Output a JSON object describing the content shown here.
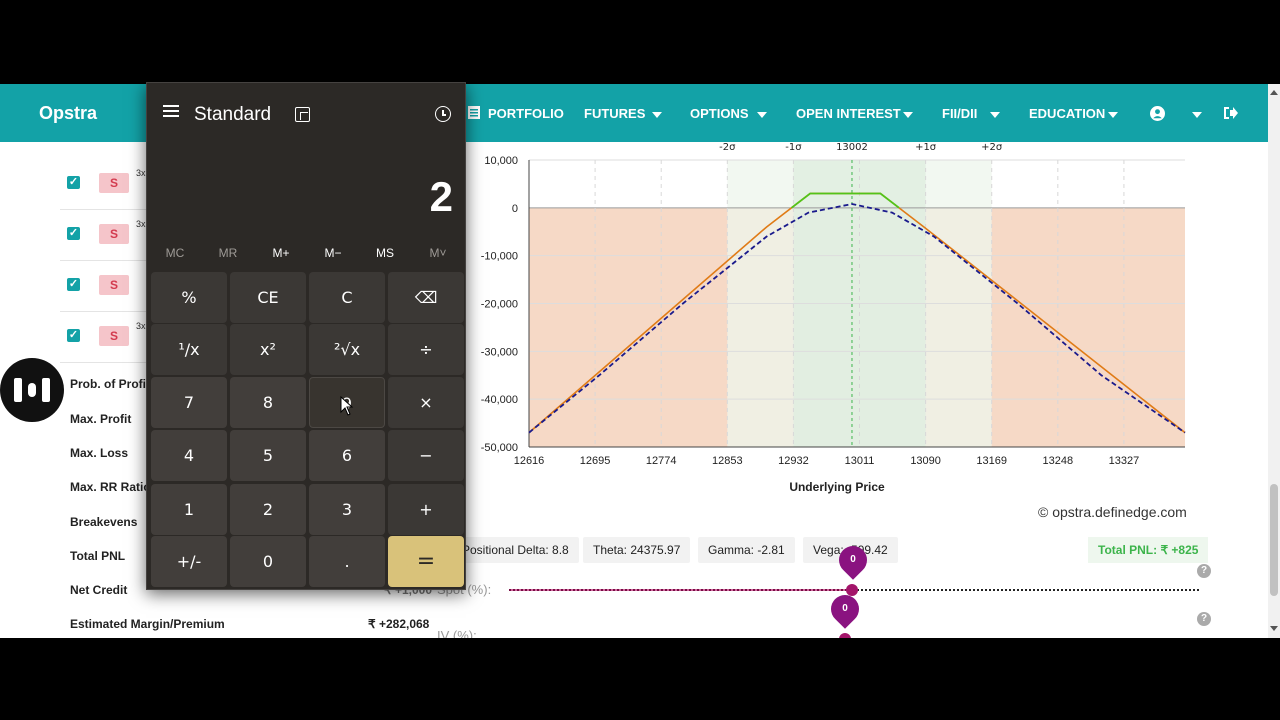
{
  "navbar": {
    "brand": "Opstra",
    "items": [
      {
        "label": "PORTFOLIO"
      },
      {
        "label": "FUTURES"
      },
      {
        "label": "OPTIONS"
      },
      {
        "label": "OPEN INTEREST"
      },
      {
        "label": "FII/DII"
      },
      {
        "label": "EDUCATION"
      }
    ],
    "color": "#13a2a7"
  },
  "legs": [
    {
      "action": "S",
      "lots": "3x",
      "checked": true
    },
    {
      "action": "S",
      "lots": "3x",
      "checked": true
    },
    {
      "action": "S",
      "lots": "",
      "checked": true
    },
    {
      "action": "S",
      "lots": "3x",
      "checked": true
    }
  ],
  "stats": [
    {
      "label": "Prob. of Profi",
      "value": ""
    },
    {
      "label": "Max. Profit",
      "value": ""
    },
    {
      "label": "Max. Loss",
      "value": ""
    },
    {
      "label": "Max. RR Ratio",
      "value": ""
    },
    {
      "label": "Breakevens",
      "value": ""
    },
    {
      "label": "Total PNL",
      "value": ""
    },
    {
      "label": "Net Credit",
      "value": "₹ +1,000"
    },
    {
      "label": "Estimated Margin/Premium",
      "value": "₹ +282,068"
    }
  ],
  "greeks": {
    "delta": "Positional Delta: 8.8",
    "theta": "Theta: 24375.97",
    "gamma": "Gamma: -2.81",
    "vega": "Vega: -599.42",
    "total_pnl": "Total PNL: ₹ +825"
  },
  "credit": "© opstra.definedge.com",
  "sliders": {
    "spot_label": "Spot (%):",
    "iv_label": "IV (%):",
    "spot_value": "0",
    "iv_value": "0"
  },
  "chart_data": {
    "type": "line",
    "xlabel": "Underlying Price",
    "x_ticks": [
      12616,
      12695,
      12774,
      12853,
      12932,
      13011,
      13090,
      13169,
      13248,
      13327
    ],
    "y_ticks": [
      10000,
      0,
      -10000,
      -20000,
      -30000,
      -40000,
      -50000
    ],
    "y_tick_labels": [
      "10,000",
      "0",
      "-10,000",
      "-20,000",
      "-30,000",
      "-40,000",
      "-50,000"
    ],
    "xlim": [
      12616,
      13400
    ],
    "ylim": [
      -50000,
      10000
    ],
    "sigma_labels": [
      "-2σ",
      "-1σ",
      "13002",
      "+1σ",
      "+2σ"
    ],
    "sigma_x": [
      12853,
      12932,
      13002,
      13090,
      13169
    ],
    "series": [
      {
        "style": "solid",
        "x": [
          12616,
          12900,
          12952,
          13036,
          13088,
          13400
        ],
        "y": [
          -47000,
          -4000,
          3000,
          3000,
          -4000,
          -47000
        ]
      },
      {
        "style": "dashed",
        "x": [
          12616,
          12700,
          12800,
          12900,
          12950,
          13002,
          13050,
          13100,
          13200,
          13300,
          13400
        ],
        "y": [
          -47000,
          -35000,
          -20000,
          -6000,
          -1000,
          800,
          -1000,
          -6000,
          -20000,
          -35000,
          -47000
        ]
      }
    ],
    "colors": {
      "payoff": "#e07b16",
      "profit": "#52c41a",
      "target": "#1a1a8c",
      "loss_fill": "#f6d9c6",
      "sigma1_fill": "#dfeee0",
      "sigma2_fill": "#edf6ec"
    }
  },
  "calculator": {
    "title": "Standard",
    "display": "2",
    "memory": [
      "MC",
      "MR",
      "M+",
      "M−",
      "MS",
      "M˅"
    ],
    "keys": [
      [
        "%",
        "CE",
        "C",
        "⌫"
      ],
      [
        "¹/x",
        "x²",
        "²√x",
        "÷"
      ],
      [
        "7",
        "8",
        "9",
        "×"
      ],
      [
        "4",
        "5",
        "6",
        "−"
      ],
      [
        "1",
        "2",
        "3",
        "+"
      ],
      [
        "+/-",
        "0",
        ".",
        "="
      ]
    ]
  }
}
